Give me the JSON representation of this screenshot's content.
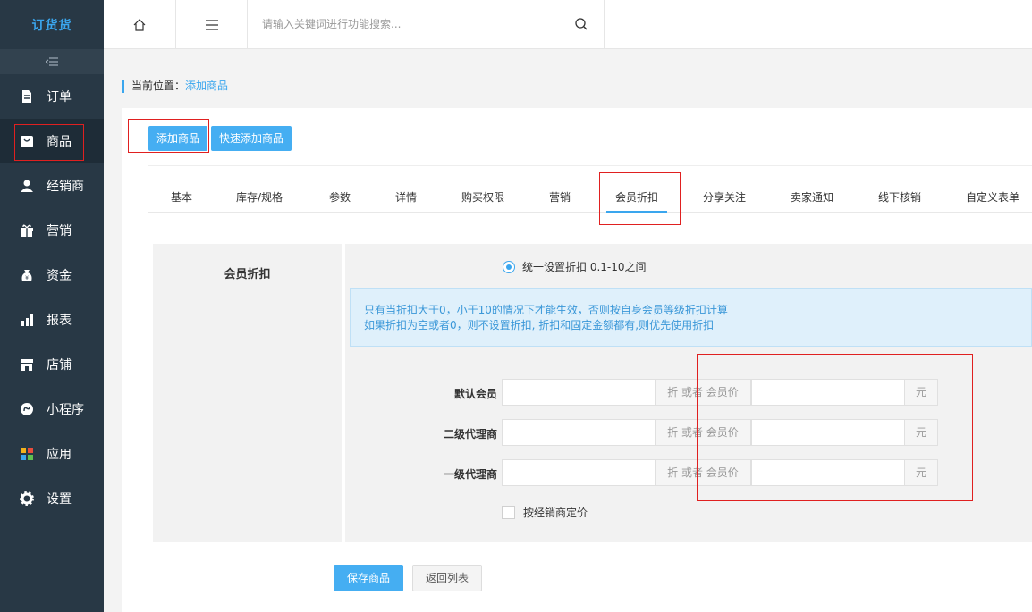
{
  "app": {
    "logo": "订货货"
  },
  "sidebar": {
    "collapse_icon": "collapse-icon",
    "items": [
      {
        "label": "订单",
        "icon": "document-icon"
      },
      {
        "label": "商品",
        "icon": "goods-icon"
      },
      {
        "label": "经销商",
        "icon": "user-icon"
      },
      {
        "label": "营销",
        "icon": "gift-icon"
      },
      {
        "label": "资金",
        "icon": "money-bag-icon"
      },
      {
        "label": "报表",
        "icon": "bar-chart-icon"
      },
      {
        "label": "店铺",
        "icon": "store-icon"
      },
      {
        "label": "小程序",
        "icon": "mini-program-icon"
      },
      {
        "label": "应用",
        "icon": "apps-icon"
      },
      {
        "label": "设置",
        "icon": "gear-icon"
      }
    ]
  },
  "topbar": {
    "search_placeholder": "请输入关键词进行功能搜索..."
  },
  "breadcrumb": {
    "prefix": "当前位置：",
    "current": "添加商品"
  },
  "actions": {
    "add": "添加商品",
    "quick_add": "快速添加商品"
  },
  "tabs": [
    "基本",
    "库存/规格",
    "参数",
    "详情",
    "购买权限",
    "营销",
    "会员折扣",
    "分享关注",
    "卖家通知",
    "线下核销",
    "自定义表单"
  ],
  "active_tab": "会员折扣",
  "form": {
    "section_label": "会员折扣",
    "radio_label": "统一设置折扣 0.1-10之间",
    "notice_line1": "只有当折扣大于0，小于10的情况下才能生效，否则按自身会员等级折扣计算",
    "notice_line2": "如果折扣为空或者0，则不设置折扣, 折扣和固定金额都有,则优先使用折扣",
    "middle_addon": "折 或者 会员价",
    "unit_addon": "元",
    "rows": [
      {
        "label": "默认会员"
      },
      {
        "label": "二级代理商"
      },
      {
        "label": "一级代理商"
      }
    ],
    "checkbox_label": "按经销商定价"
  },
  "footer": {
    "save": "保存商品",
    "back": "返回列表"
  },
  "colors": {
    "sidebar": "#283845",
    "accent": "#3aa6ee",
    "highlight": "#e02020"
  }
}
